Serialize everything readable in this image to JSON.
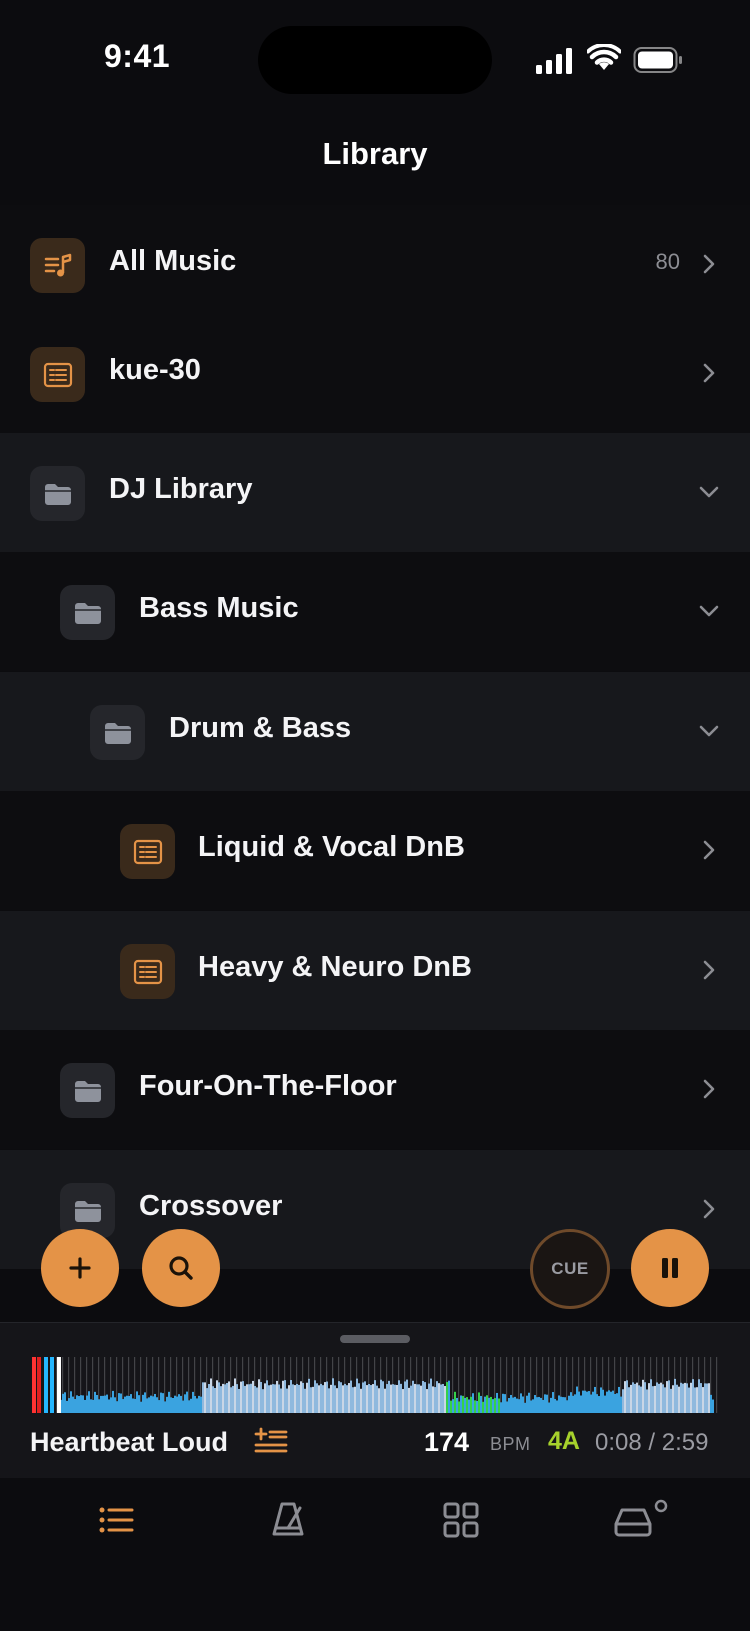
{
  "status_bar": {
    "time": "9:41"
  },
  "header": {
    "title": "Library"
  },
  "library": {
    "rows": [
      {
        "label": "All Music",
        "count": "80",
        "icon": "music-list-icon"
      },
      {
        "label": "kue-30",
        "icon": "playlist-icon"
      },
      {
        "label": "DJ Library",
        "icon": "folder-icon",
        "expanded": true
      },
      {
        "label": "Bass Music",
        "icon": "folder-icon",
        "expanded": true
      },
      {
        "label": "Drum & Bass",
        "icon": "folder-icon",
        "expanded": true
      },
      {
        "label": "Liquid & Vocal DnB",
        "icon": "playlist-icon"
      },
      {
        "label": "Heavy & Neuro DnB",
        "icon": "playlist-icon"
      },
      {
        "label": "Four-On-The-Floor",
        "icon": "folder-icon"
      },
      {
        "label": "Crossover",
        "icon": "folder-icon"
      }
    ]
  },
  "controls": {
    "cue_label": "CUE"
  },
  "player": {
    "track_title": "Heartbeat Loud",
    "bpm": "174",
    "bpm_label": "BPM",
    "key": "4A",
    "time": "0:08 / 2:59",
    "progress_fraction": 0.045
  },
  "tabs": [
    "list-icon",
    "metronome-icon",
    "grid-icon",
    "drive-icon"
  ],
  "colors": {
    "accent": "#e49347",
    "key": "#a6d12c",
    "background": "#0c0c0f"
  }
}
